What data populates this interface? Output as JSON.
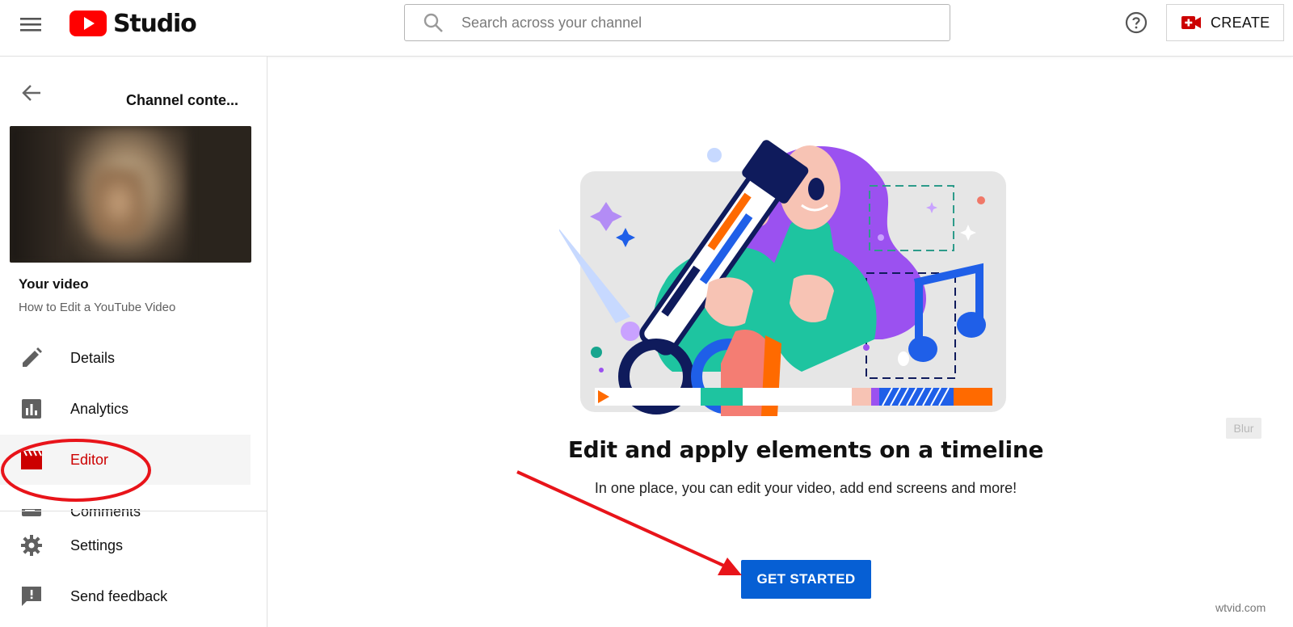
{
  "app": {
    "name": "Studio"
  },
  "search": {
    "placeholder": "Search across your channel"
  },
  "header": {
    "create_label": "CREATE"
  },
  "sidebar": {
    "channel_title": "Channel conte...",
    "your_video_label": "Your video",
    "video_title": "How to Edit a YouTube Video",
    "items": [
      {
        "label": "Details",
        "icon": "pencil-icon"
      },
      {
        "label": "Analytics",
        "icon": "analytics-icon"
      },
      {
        "label": "Editor",
        "icon": "clapperboard-icon",
        "active": true
      },
      {
        "label": "Comments",
        "icon": "comments-icon"
      },
      {
        "label": "Settings",
        "icon": "gear-icon"
      },
      {
        "label": "Send feedback",
        "icon": "feedback-icon"
      }
    ]
  },
  "main": {
    "headline": "Edit and apply elements on a timeline",
    "subtext": "In one place, you can edit your video, add end screens and more!",
    "get_started_label": "GET STARTED",
    "blur_label": "Blur"
  },
  "watermark": "wtvid.com",
  "colors": {
    "brand_red": "#ff0000",
    "active_red": "#cc0000",
    "primary_blue": "#065fd4",
    "annotation_red": "#e8141a"
  }
}
